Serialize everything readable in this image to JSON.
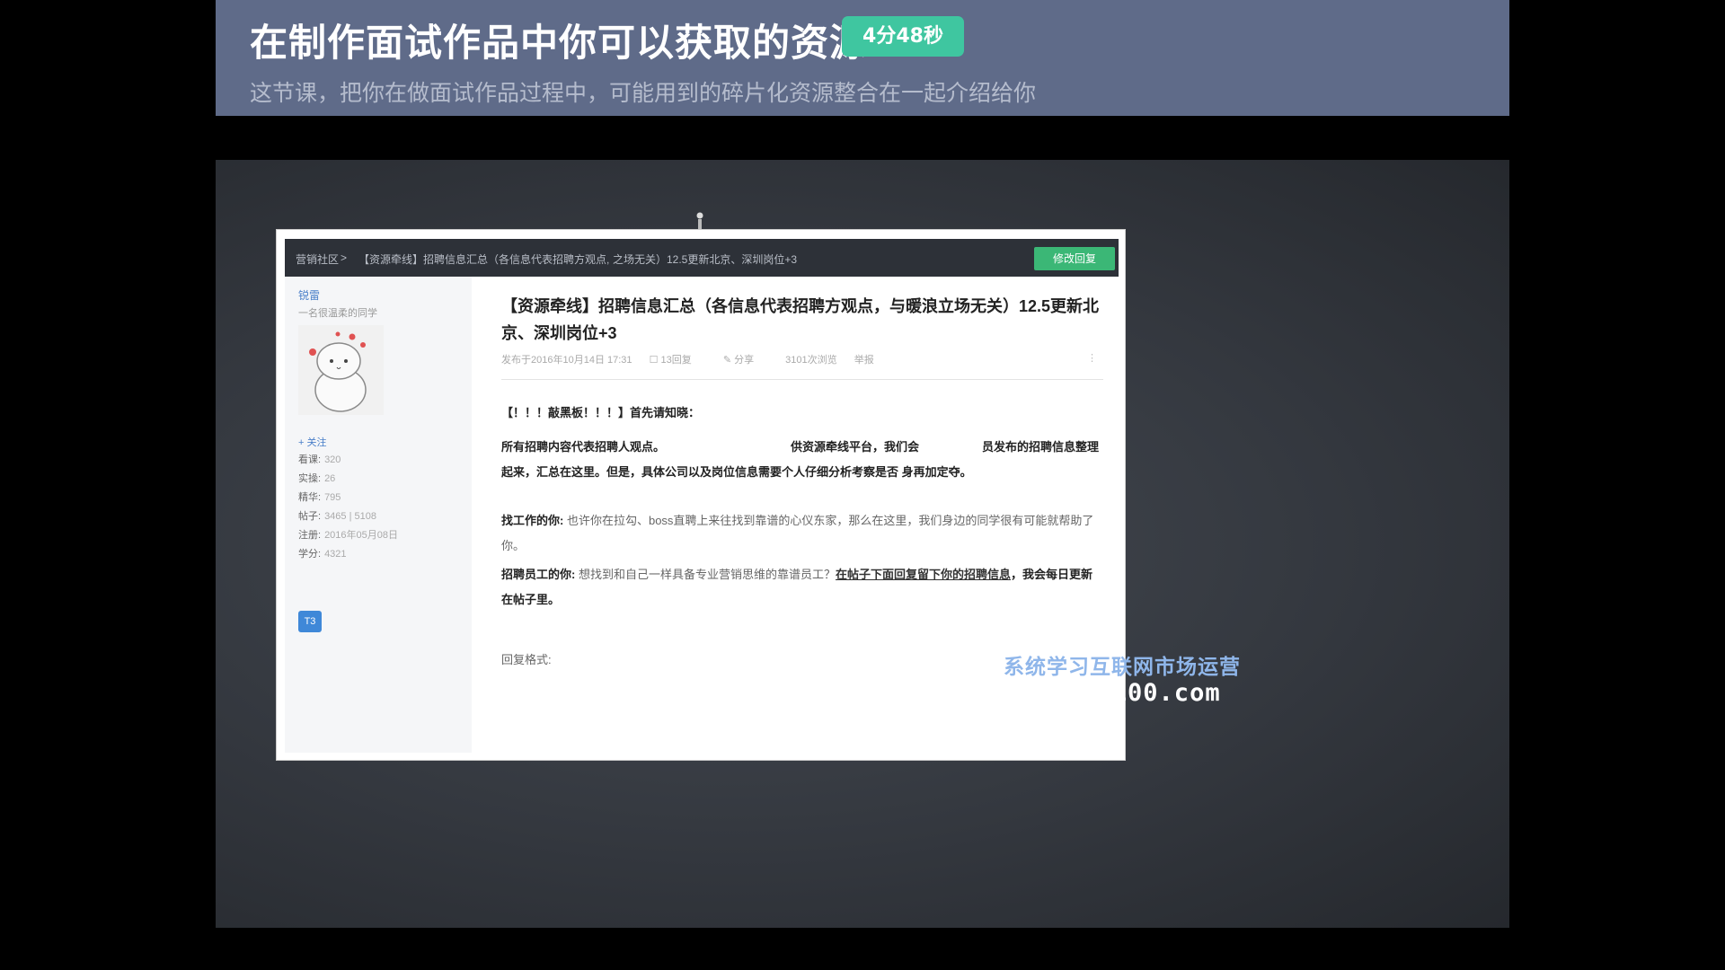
{
  "header": {
    "title": "在制作面试作品中你可以获取的资源",
    "duration": "4分48秒",
    "subtitle": "这节课，把你在做面试作品过程中，可能用到的碎片化资源整合在一起介绍给你"
  },
  "forum": {
    "breadcrumb_home": "营销社区",
    "breadcrumb_sep": ">",
    "breadcrumb_title_a": "【资源牵线】招聘信息汇总（各信息代表招聘方观点,",
    "breadcrumb_title_b": "之场无关）12.5更新北京、深圳岗位+3",
    "edit_button": "修改回复",
    "user": {
      "name": "锐雷",
      "signature": "一名很温柔的同学",
      "follow": "+ 关注",
      "stats": [
        {
          "label": "看课:",
          "value": "320"
        },
        {
          "label": "实操:",
          "value": "26"
        },
        {
          "label": "精华:",
          "value": "795"
        },
        {
          "label": "帖子:",
          "value": "3465 | 5108"
        },
        {
          "label": "注册:",
          "value": "2016年05月08日"
        },
        {
          "label": "学分:",
          "value": "4321"
        }
      ],
      "level": "T3"
    },
    "post": {
      "title": "【资源牵线】招聘信息汇总（各信息代表招聘方观点，与暖浪立场无关）12.5更新北京、深圳岗位+3",
      "meta_date": "发布于2016年10月14日 17:31",
      "meta_replies": "13回复",
      "meta_share": "分享",
      "meta_views": "3101次浏览",
      "meta_fav": "举报",
      "meta_more": "⋮",
      "notice": "【！！！敲黑板！！！】首先请知晓：",
      "p1_a": "所有招聘内容代表招聘人观点。",
      "p1_b": "供资源牵线平台，我们会",
      "p1_c": "员发布的招聘信息整理起来，汇总在这里。但是，具体公司以及岗位信息需要个人仔细分析考察是否",
      "p1_d": "身再加定夺。",
      "p2_label": "找工作的你:",
      "p2_text": "也许你在拉勾、boss直聘上来往找到靠谱的心仪东家，那么在这里，我们身边的同学很有可能就帮助了你。",
      "p3_label": "招聘员工的你:",
      "p3_text": "想找到和自己一样具备专业营销思维的靠谱员工？",
      "p3_link": "在帖子下面回复留下你的招聘信息",
      "p3_tail": "，我会每日更新在帖子里。",
      "reply_format": "回复格式:"
    }
  },
  "watermark": {
    "line1": "系统学习互联网市场运营",
    "line2": "nuanshi100.com"
  }
}
